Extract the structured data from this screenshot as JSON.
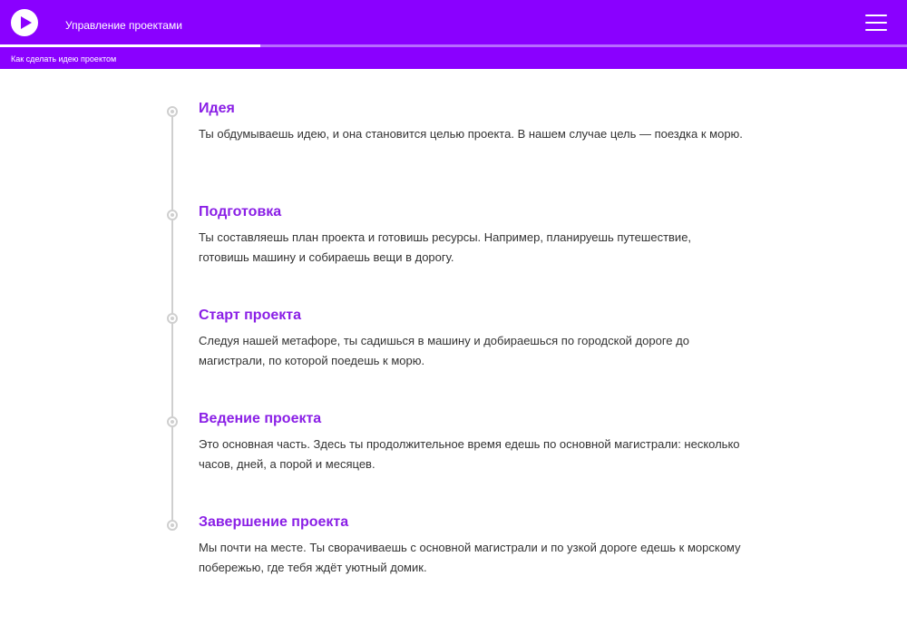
{
  "header": {
    "course_title": "Управление проектами",
    "lesson_title": "Как сделать идею проектом",
    "progress_percent": 28.7,
    "accent_color": "#8a00ff",
    "play_icon": "play-icon",
    "menu_icon": "hamburger-menu-icon"
  },
  "steps": [
    {
      "title": "Идея",
      "text": "Ты обдумываешь идею, и она становится целью проекта. В нашем случае цель — поездка к морю."
    },
    {
      "title": "Подготовка",
      "text": "Ты составляешь план проекта и готовишь ресурсы. Например, планируешь путешествие, готовишь машину и собираешь вещи в дорогу."
    },
    {
      "title": "Старт проекта",
      "text": "Следуя нашей метафоре, ты садишься в машину и добираешься по городской дороге до магистрали, по которой поедешь к морю."
    },
    {
      "title": "Ведение проекта",
      "text": "Это основная часть. Здесь ты продолжительное время едешь по основной магистрали: несколько часов, дней, а порой и месяцев."
    },
    {
      "title": "Завершение проекта",
      "text": "Мы почти на месте. Ты сворачиваешь с основной магистрали и по узкой дороге едешь к морскому побережью, где тебя ждёт уютный домик."
    }
  ]
}
